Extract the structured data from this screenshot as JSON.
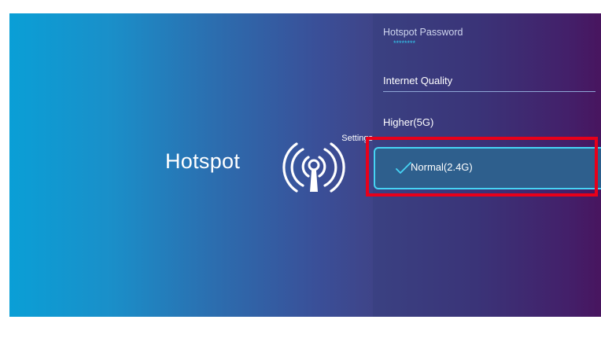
{
  "header": {
    "section": "Settings",
    "title": "Hotspot",
    "icon": "wifi-antenna-icon"
  },
  "hotspot_password": {
    "label": "Hotspot Password",
    "value": "********"
  },
  "internet_quality": {
    "label": "Internet Quality",
    "options": [
      {
        "label": "Higher(5G)",
        "selected": false
      },
      {
        "label": "Normal(2.4G)",
        "selected": true
      }
    ]
  },
  "colors": {
    "accent": "#46d4f5",
    "highlight_frame": "#e8001a",
    "selected_fill": "#2e5f8d"
  }
}
